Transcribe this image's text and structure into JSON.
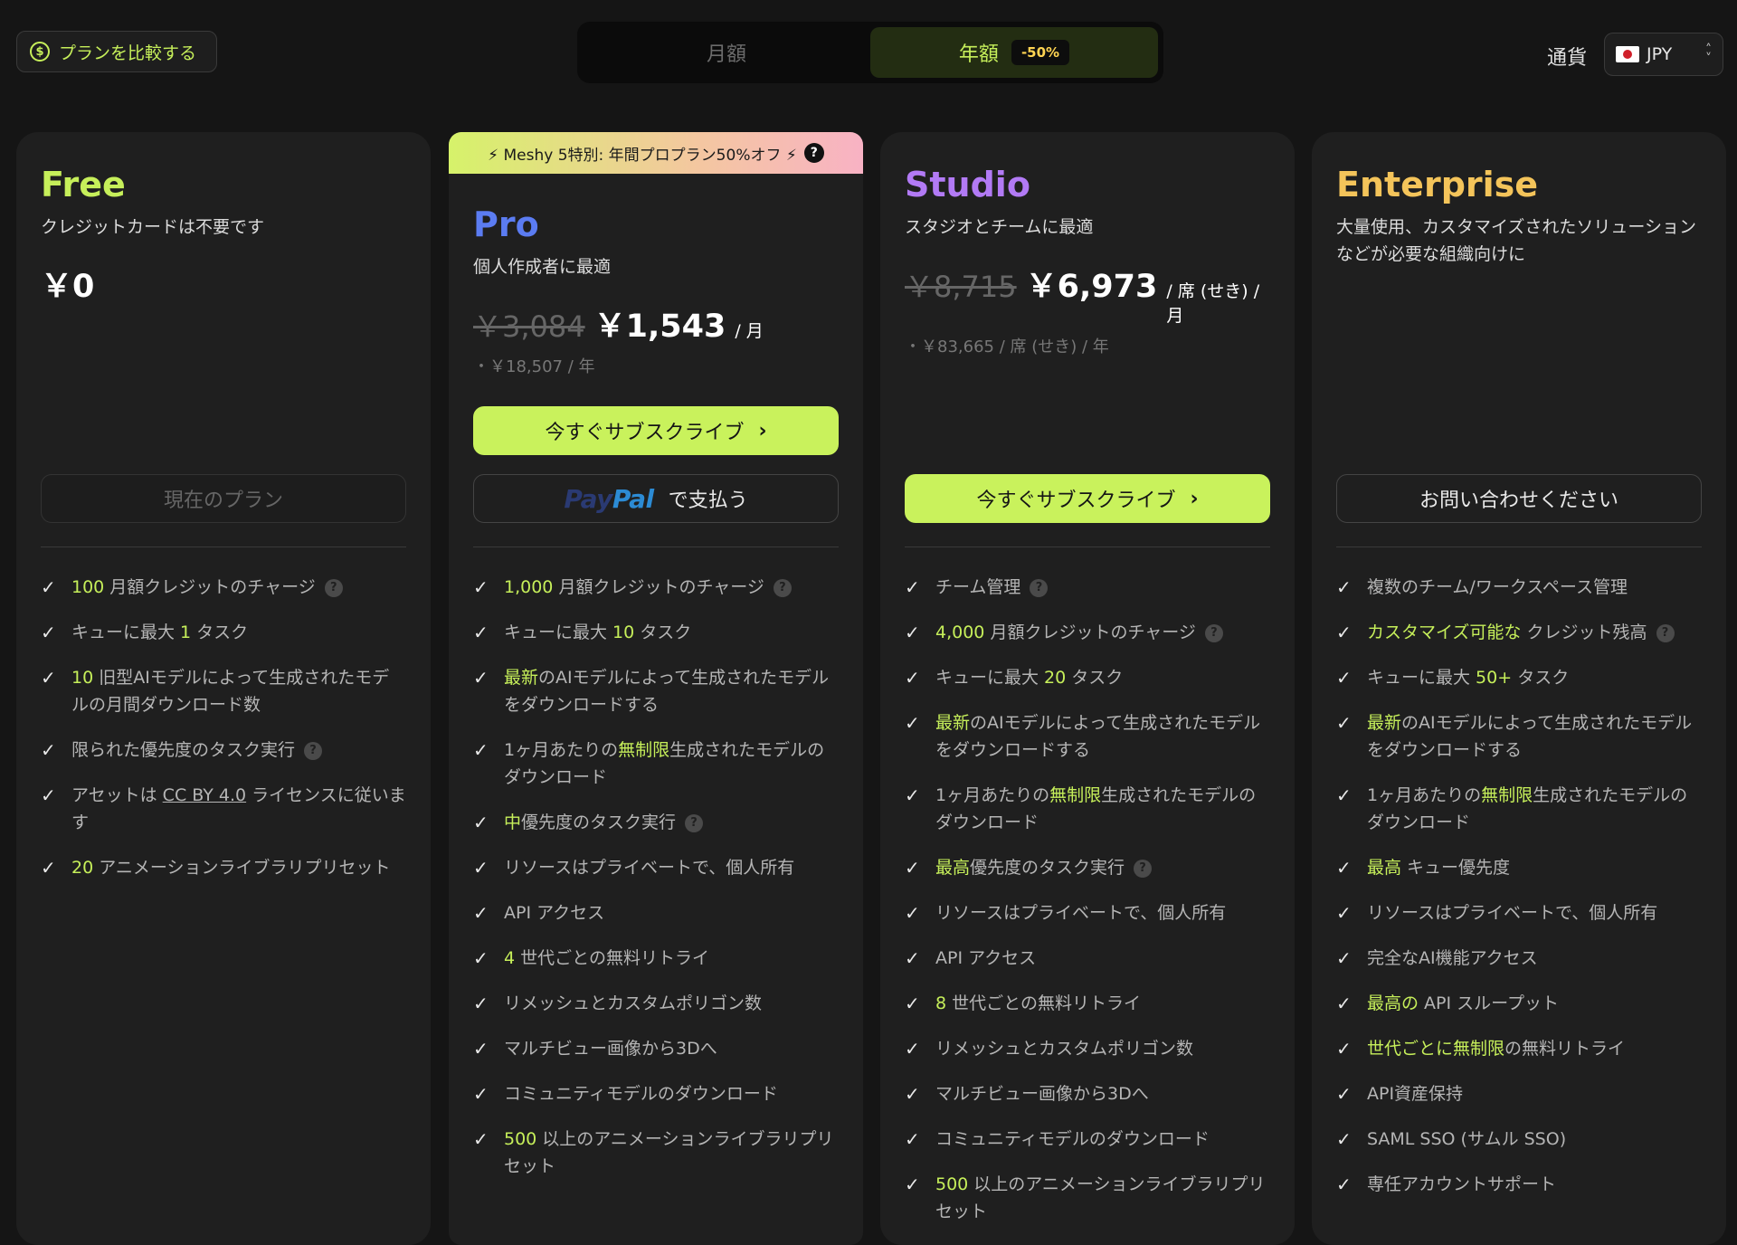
{
  "header": {
    "compare_label": "プランを比較する",
    "billing_monthly": "月額",
    "billing_yearly": "年額",
    "yearly_badge": "-50%",
    "currency_label": "通貨",
    "currency_value": "JPY"
  },
  "plans": {
    "free": {
      "name": "Free",
      "desc": "クレジットカードは不要です",
      "price": "￥0",
      "button": "現在のプラン",
      "features": [
        "<span class='hl'>100</span> 月額クレジットのチャージ <span class='q'>?</span>",
        "キューに最大 <span class='hl'>1</span> タスク",
        "<span class='hl'>10</span> 旧型AIモデルによって生成されたモデルの月間ダウンロード数",
        "限られた優先度のタスク実行 <span class='q'>?</span>",
        "アセットは <span class='u'>CC BY 4.0</span> ライセンスに従います",
        "<span class='hl'>20</span> アニメーションライブラリプリセット"
      ]
    },
    "pro": {
      "banner": "⚡ Meshy 5特別: 年間プロプラン50%オフ ⚡",
      "name": "Pro",
      "desc": "個人作成者に最適",
      "price_old": "￥3,084",
      "price_now": "￥1,543",
      "price_unit": "/ 月",
      "price_annual": "・￥18,507 / 年",
      "button": "今すぐサブスクライブ",
      "paypal_suffix": "で支払う",
      "features": [
        "<span class='hl'>1,000</span> 月額クレジットのチャージ <span class='q'>?</span>",
        "キューに最大 <span class='hl'>10</span> タスク",
        "<span class='hl'>最新</span>のAIモデルによって生成されたモデルをダウンロードする",
        "1ヶ月あたりの<span class='hl'>無制限</span>生成されたモデルのダウンロード",
        "<span class='hl'>中</span>優先度のタスク実行 <span class='q'>?</span>",
        "リソースはプライベートで、個人所有",
        "API アクセス",
        "<span class='hl'>4</span> 世代ごとの無料リトライ",
        "リメッシュとカスタムポリゴン数",
        "マルチビュー画像から3Dへ",
        "コミュニティモデルのダウンロード",
        "<span class='hl'>500</span> 以上のアニメーションライブラリプリセット"
      ]
    },
    "studio": {
      "name": "Studio",
      "desc": "スタジオとチームに最適",
      "price_old": "￥8,715",
      "price_now": "￥6,973",
      "price_unit": "/ 席 (せき) / 月",
      "price_annual": "・￥83,665 / 席 (せき) / 年",
      "button": "今すぐサブスクライブ",
      "features": [
        "チーム管理 <span class='q'>?</span>",
        "<span class='hl'>4,000</span> 月額クレジットのチャージ <span class='q'>?</span>",
        "キューに最大 <span class='hl'>20</span> タスク",
        "<span class='hl'>最新</span>のAIモデルによって生成されたモデルをダウンロードする",
        "1ヶ月あたりの<span class='hl'>無制限</span>生成されたモデルのダウンロード",
        "<span class='hl'>最高</span>優先度のタスク実行 <span class='q'>?</span>",
        "リソースはプライベートで、個人所有",
        "API アクセス",
        "<span class='hl'>8</span> 世代ごとの無料リトライ",
        "リメッシュとカスタムポリゴン数",
        "マルチビュー画像から3Dへ",
        "コミュニティモデルのダウンロード",
        "<span class='hl'>500</span> 以上のアニメーションライブラリプリセット"
      ]
    },
    "enterprise": {
      "name": "Enterprise",
      "desc": "大量使用、カスタマイズされたソリューションなどが必要な組織向けに",
      "button": "お問い合わせください",
      "features": [
        "複数のチーム/ワークスペース管理",
        "<span class='hl'>カスタマイズ可能な</span> クレジット残高 <span class='q'>?</span>",
        "キューに最大 <span class='hl'>50+</span> タスク",
        "<span class='hl'>最新</span>のAIモデルによって生成されたモデルをダウンロードする",
        "1ヶ月あたりの<span class='hl'>無制限</span>生成されたモデルのダウンロード",
        "<span class='hl'>最高</span> キュー優先度",
        "リソースはプライベートで、個人所有",
        "完全なAI機能アクセス",
        "<span class='hl'>最高の</span> API スループット",
        "<span class='hl'>世代ごとに無制限</span>の無料リトライ",
        "API資産保持",
        "SAML SSO (サムル SSO)",
        "専任アカウントサポート"
      ]
    }
  },
  "colors": {
    "free": "#c6ef5a",
    "pro": "#5b7cf2",
    "studio": "#b27af5",
    "enterprise": "#f4c45a",
    "accent": "#c9f25c"
  }
}
